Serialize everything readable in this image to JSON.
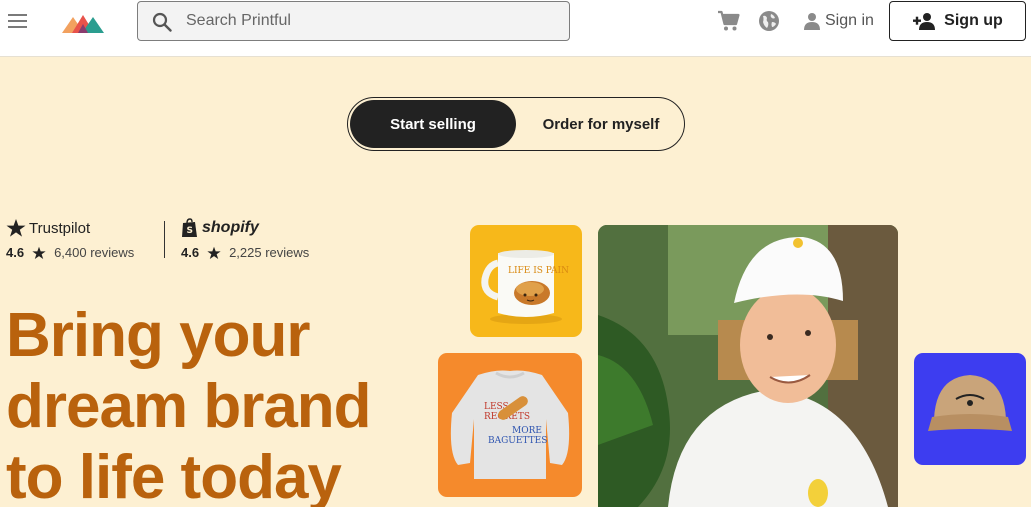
{
  "header": {
    "search_placeholder": "Search Printful",
    "signin_label": "Sign in",
    "signup_label": "Sign up"
  },
  "toggle": {
    "active_label": "Start selling",
    "inactive_label": "Order for myself"
  },
  "ratings": {
    "trustpilot": {
      "brand": "Trustpilot",
      "score": "4.6",
      "reviews": "6,400 reviews"
    },
    "shopify": {
      "brand": "shopify",
      "score": "4.6",
      "reviews": "2,225 reviews"
    }
  },
  "hero": {
    "headline_lines": [
      "Bring your",
      "dream brand",
      "to life today"
    ]
  },
  "products": {
    "mug_text": "LIFE IS PAIN",
    "sweatshirt_text_1": "LESS",
    "sweatshirt_text_2": "REGRETS",
    "sweatshirt_text_3": "MORE",
    "sweatshirt_text_4": "BAGUETTES"
  },
  "colors": {
    "background": "#fdf0d2",
    "headline": "#b9620d",
    "mug_tile": "#f7b81a",
    "sweatshirt_tile": "#f58a2c",
    "cap_tile": "#3d3df0",
    "button_dark": "#222222"
  },
  "icons": [
    "menu-icon",
    "printful-logo",
    "search-icon",
    "cart-icon",
    "globe-icon",
    "user-icon",
    "add-user-icon",
    "star-icon"
  ]
}
